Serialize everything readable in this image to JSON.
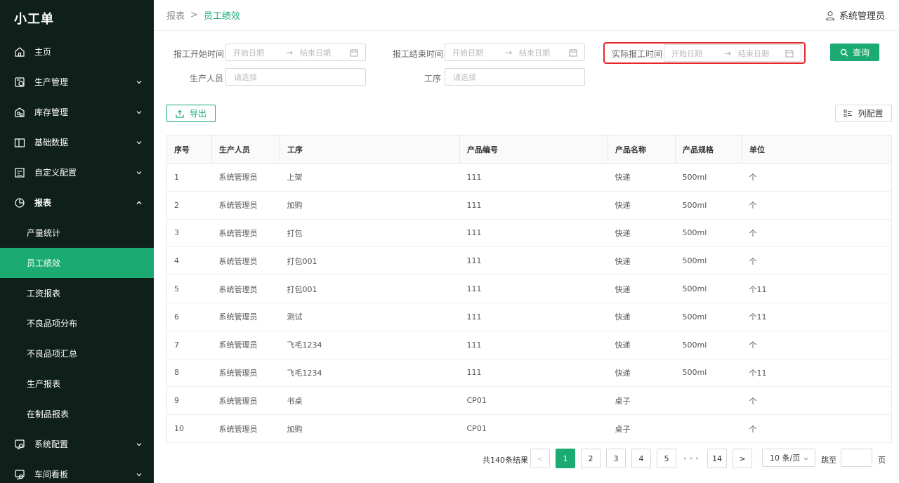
{
  "app": {
    "title": "小工单"
  },
  "sidebar": {
    "items": [
      {
        "label": "主页",
        "icon": "home-icon"
      },
      {
        "label": "生产管理",
        "icon": "production-icon"
      },
      {
        "label": "库存管理",
        "icon": "inventory-icon"
      },
      {
        "label": "基础数据",
        "icon": "database-icon"
      },
      {
        "label": "自定义配置",
        "icon": "config-icon"
      },
      {
        "label": "报表",
        "icon": "chart-icon"
      }
    ],
    "report_sub": [
      {
        "label": "产量统计"
      },
      {
        "label": "员工绩效"
      },
      {
        "label": "工资报表"
      },
      {
        "label": "不良品项分布"
      },
      {
        "label": "不良品项汇总"
      },
      {
        "label": "生产报表"
      },
      {
        "label": "在制品报表"
      }
    ],
    "bottom_items": [
      {
        "label": "系统配置",
        "icon": "settings-icon"
      },
      {
        "label": "车间看板",
        "icon": "board-icon"
      }
    ]
  },
  "header": {
    "breadcrumb_root": "报表",
    "breadcrumb_sep": ">",
    "breadcrumb_current": "员工绩效",
    "user_name": "系统管理员"
  },
  "filters": {
    "start_label": "报工开始时间",
    "end_label": "报工结束时间",
    "actual_label": "实际报工时间",
    "start_placeholder": "开始日期",
    "end_placeholder": "结束日期",
    "arrow": "→",
    "staff_label": "生产人员",
    "process_label": "工序",
    "select_placeholder": "请选择",
    "query_button": "查询"
  },
  "toolbar": {
    "export_button": "导出",
    "columns_button": "列配置"
  },
  "table": {
    "headers": [
      "序号",
      "生产人员",
      "工序",
      "产品编号",
      "产品名称",
      "产品规格",
      "单位"
    ],
    "rows": [
      [
        "1",
        "系统管理员",
        "上架",
        "111",
        "快递",
        "500ml",
        "个"
      ],
      [
        "2",
        "系统管理员",
        "加购",
        "111",
        "快递",
        "500ml",
        "个"
      ],
      [
        "3",
        "系统管理员",
        "打包",
        "111",
        "快递",
        "500ml",
        "个"
      ],
      [
        "4",
        "系统管理员",
        "打包001",
        "111",
        "快递",
        "500ml",
        "个"
      ],
      [
        "5",
        "系统管理员",
        "打包001",
        "111",
        "快递",
        "500ml",
        "个11"
      ],
      [
        "6",
        "系统管理员",
        "测试",
        "111",
        "快递",
        "500ml",
        "个11"
      ],
      [
        "7",
        "系统管理员",
        "飞毛1234",
        "111",
        "快递",
        "500ml",
        "个"
      ],
      [
        "8",
        "系统管理员",
        "飞毛1234",
        "111",
        "快递",
        "500ml",
        "个11"
      ],
      [
        "9",
        "系统管理员",
        "书桌",
        "CP01",
        "桌子",
        "",
        "个"
      ],
      [
        "10",
        "系统管理员",
        "加购",
        "CP01",
        "桌子",
        "",
        "个"
      ]
    ]
  },
  "pagination": {
    "total_text": "共140条结果",
    "pages": [
      "1",
      "2",
      "3",
      "4",
      "5"
    ],
    "dots": "•••",
    "last_page": "14",
    "prev": "<",
    "next": ">",
    "page_size": "10 条/页",
    "jump_label": "跳至",
    "jump_suffix": "页"
  },
  "colors": {
    "accent": "#1aaa72",
    "sidebar_bg": "#0f1f19",
    "highlight": "#e3262c"
  }
}
